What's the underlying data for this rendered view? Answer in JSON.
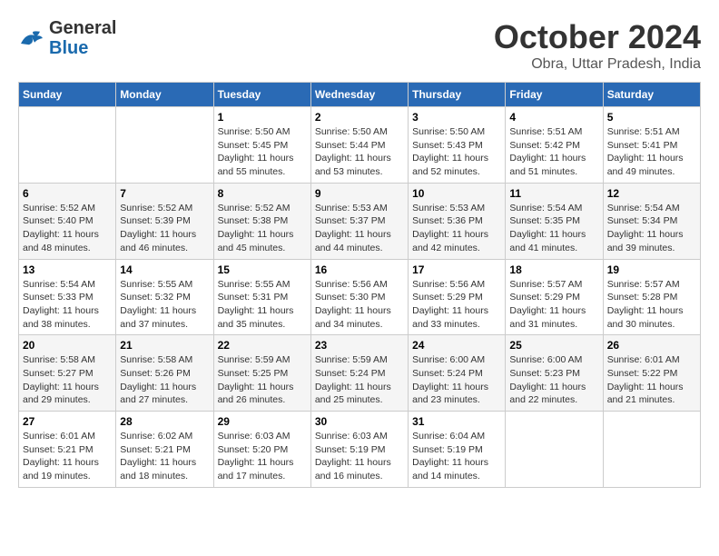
{
  "header": {
    "logo_general": "General",
    "logo_blue": "Blue",
    "month_title": "October 2024",
    "location": "Obra, Uttar Pradesh, India"
  },
  "weekdays": [
    "Sunday",
    "Monday",
    "Tuesday",
    "Wednesday",
    "Thursday",
    "Friday",
    "Saturday"
  ],
  "weeks": [
    [
      {
        "day": "",
        "info": ""
      },
      {
        "day": "",
        "info": ""
      },
      {
        "day": "1",
        "sunrise": "5:50 AM",
        "sunset": "5:45 PM",
        "daylight": "11 hours and 55 minutes."
      },
      {
        "day": "2",
        "sunrise": "5:50 AM",
        "sunset": "5:44 PM",
        "daylight": "11 hours and 53 minutes."
      },
      {
        "day": "3",
        "sunrise": "5:50 AM",
        "sunset": "5:43 PM",
        "daylight": "11 hours and 52 minutes."
      },
      {
        "day": "4",
        "sunrise": "5:51 AM",
        "sunset": "5:42 PM",
        "daylight": "11 hours and 51 minutes."
      },
      {
        "day": "5",
        "sunrise": "5:51 AM",
        "sunset": "5:41 PM",
        "daylight": "11 hours and 49 minutes."
      }
    ],
    [
      {
        "day": "6",
        "sunrise": "5:52 AM",
        "sunset": "5:40 PM",
        "daylight": "11 hours and 48 minutes."
      },
      {
        "day": "7",
        "sunrise": "5:52 AM",
        "sunset": "5:39 PM",
        "daylight": "11 hours and 46 minutes."
      },
      {
        "day": "8",
        "sunrise": "5:52 AM",
        "sunset": "5:38 PM",
        "daylight": "11 hours and 45 minutes."
      },
      {
        "day": "9",
        "sunrise": "5:53 AM",
        "sunset": "5:37 PM",
        "daylight": "11 hours and 44 minutes."
      },
      {
        "day": "10",
        "sunrise": "5:53 AM",
        "sunset": "5:36 PM",
        "daylight": "11 hours and 42 minutes."
      },
      {
        "day": "11",
        "sunrise": "5:54 AM",
        "sunset": "5:35 PM",
        "daylight": "11 hours and 41 minutes."
      },
      {
        "day": "12",
        "sunrise": "5:54 AM",
        "sunset": "5:34 PM",
        "daylight": "11 hours and 39 minutes."
      }
    ],
    [
      {
        "day": "13",
        "sunrise": "5:54 AM",
        "sunset": "5:33 PM",
        "daylight": "11 hours and 38 minutes."
      },
      {
        "day": "14",
        "sunrise": "5:55 AM",
        "sunset": "5:32 PM",
        "daylight": "11 hours and 37 minutes."
      },
      {
        "day": "15",
        "sunrise": "5:55 AM",
        "sunset": "5:31 PM",
        "daylight": "11 hours and 35 minutes."
      },
      {
        "day": "16",
        "sunrise": "5:56 AM",
        "sunset": "5:30 PM",
        "daylight": "11 hours and 34 minutes."
      },
      {
        "day": "17",
        "sunrise": "5:56 AM",
        "sunset": "5:29 PM",
        "daylight": "11 hours and 33 minutes."
      },
      {
        "day": "18",
        "sunrise": "5:57 AM",
        "sunset": "5:29 PM",
        "daylight": "11 hours and 31 minutes."
      },
      {
        "day": "19",
        "sunrise": "5:57 AM",
        "sunset": "5:28 PM",
        "daylight": "11 hours and 30 minutes."
      }
    ],
    [
      {
        "day": "20",
        "sunrise": "5:58 AM",
        "sunset": "5:27 PM",
        "daylight": "11 hours and 29 minutes."
      },
      {
        "day": "21",
        "sunrise": "5:58 AM",
        "sunset": "5:26 PM",
        "daylight": "11 hours and 27 minutes."
      },
      {
        "day": "22",
        "sunrise": "5:59 AM",
        "sunset": "5:25 PM",
        "daylight": "11 hours and 26 minutes."
      },
      {
        "day": "23",
        "sunrise": "5:59 AM",
        "sunset": "5:24 PM",
        "daylight": "11 hours and 25 minutes."
      },
      {
        "day": "24",
        "sunrise": "6:00 AM",
        "sunset": "5:24 PM",
        "daylight": "11 hours and 23 minutes."
      },
      {
        "day": "25",
        "sunrise": "6:00 AM",
        "sunset": "5:23 PM",
        "daylight": "11 hours and 22 minutes."
      },
      {
        "day": "26",
        "sunrise": "6:01 AM",
        "sunset": "5:22 PM",
        "daylight": "11 hours and 21 minutes."
      }
    ],
    [
      {
        "day": "27",
        "sunrise": "6:01 AM",
        "sunset": "5:21 PM",
        "daylight": "11 hours and 19 minutes."
      },
      {
        "day": "28",
        "sunrise": "6:02 AM",
        "sunset": "5:21 PM",
        "daylight": "11 hours and 18 minutes."
      },
      {
        "day": "29",
        "sunrise": "6:03 AM",
        "sunset": "5:20 PM",
        "daylight": "11 hours and 17 minutes."
      },
      {
        "day": "30",
        "sunrise": "6:03 AM",
        "sunset": "5:19 PM",
        "daylight": "11 hours and 16 minutes."
      },
      {
        "day": "31",
        "sunrise": "6:04 AM",
        "sunset": "5:19 PM",
        "daylight": "11 hours and 14 minutes."
      },
      {
        "day": "",
        "info": ""
      },
      {
        "day": "",
        "info": ""
      }
    ]
  ]
}
